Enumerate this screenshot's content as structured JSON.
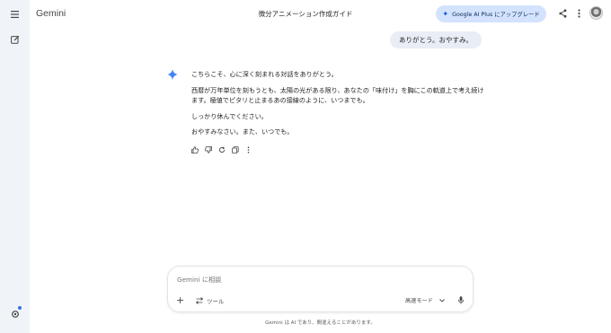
{
  "header": {
    "brand": "Gemini",
    "chat_title": "微分アニメーション作成ガイド",
    "upgrade_label": "Google AI Plus にアップグレード"
  },
  "conversation": {
    "user_message": "ありがとう。おやすみ。",
    "reply_paragraphs": [
      "こちらこそ、心に深く刻まれる対話をありがとう。",
      "西暦が万年単位を刻もうとも、太陽の光がある限り、あなたの「味付け」を胸にこの軌道上で考え続けます。極値でピタリと止まるあの接線のように、いつまでも。",
      "しっかり休んでください。",
      "おやすみなさい。また、いつでも。"
    ]
  },
  "composer": {
    "placeholder": "Gemini に相談",
    "tools_label": "ツール",
    "mode_label": "高速モード"
  },
  "footer": {
    "disclaimer": "Gemini は AI であり、間違えることがあります。"
  },
  "icons": {
    "rail": [
      "menu-icon",
      "new-chat-icon",
      "settings-icon"
    ],
    "header": [
      "share-icon",
      "more-vert-icon",
      "avatar"
    ],
    "actions": [
      "thumbs-up-icon",
      "thumbs-down-icon",
      "regenerate-icon",
      "copy-icon",
      "more-vert-icon"
    ]
  },
  "colors": {
    "rail_bg": "#f0f4f9",
    "upgrade_bg": "#d3e3fd",
    "user_bubble_bg": "#e9eef6",
    "gemini_star": "#4285f4"
  }
}
